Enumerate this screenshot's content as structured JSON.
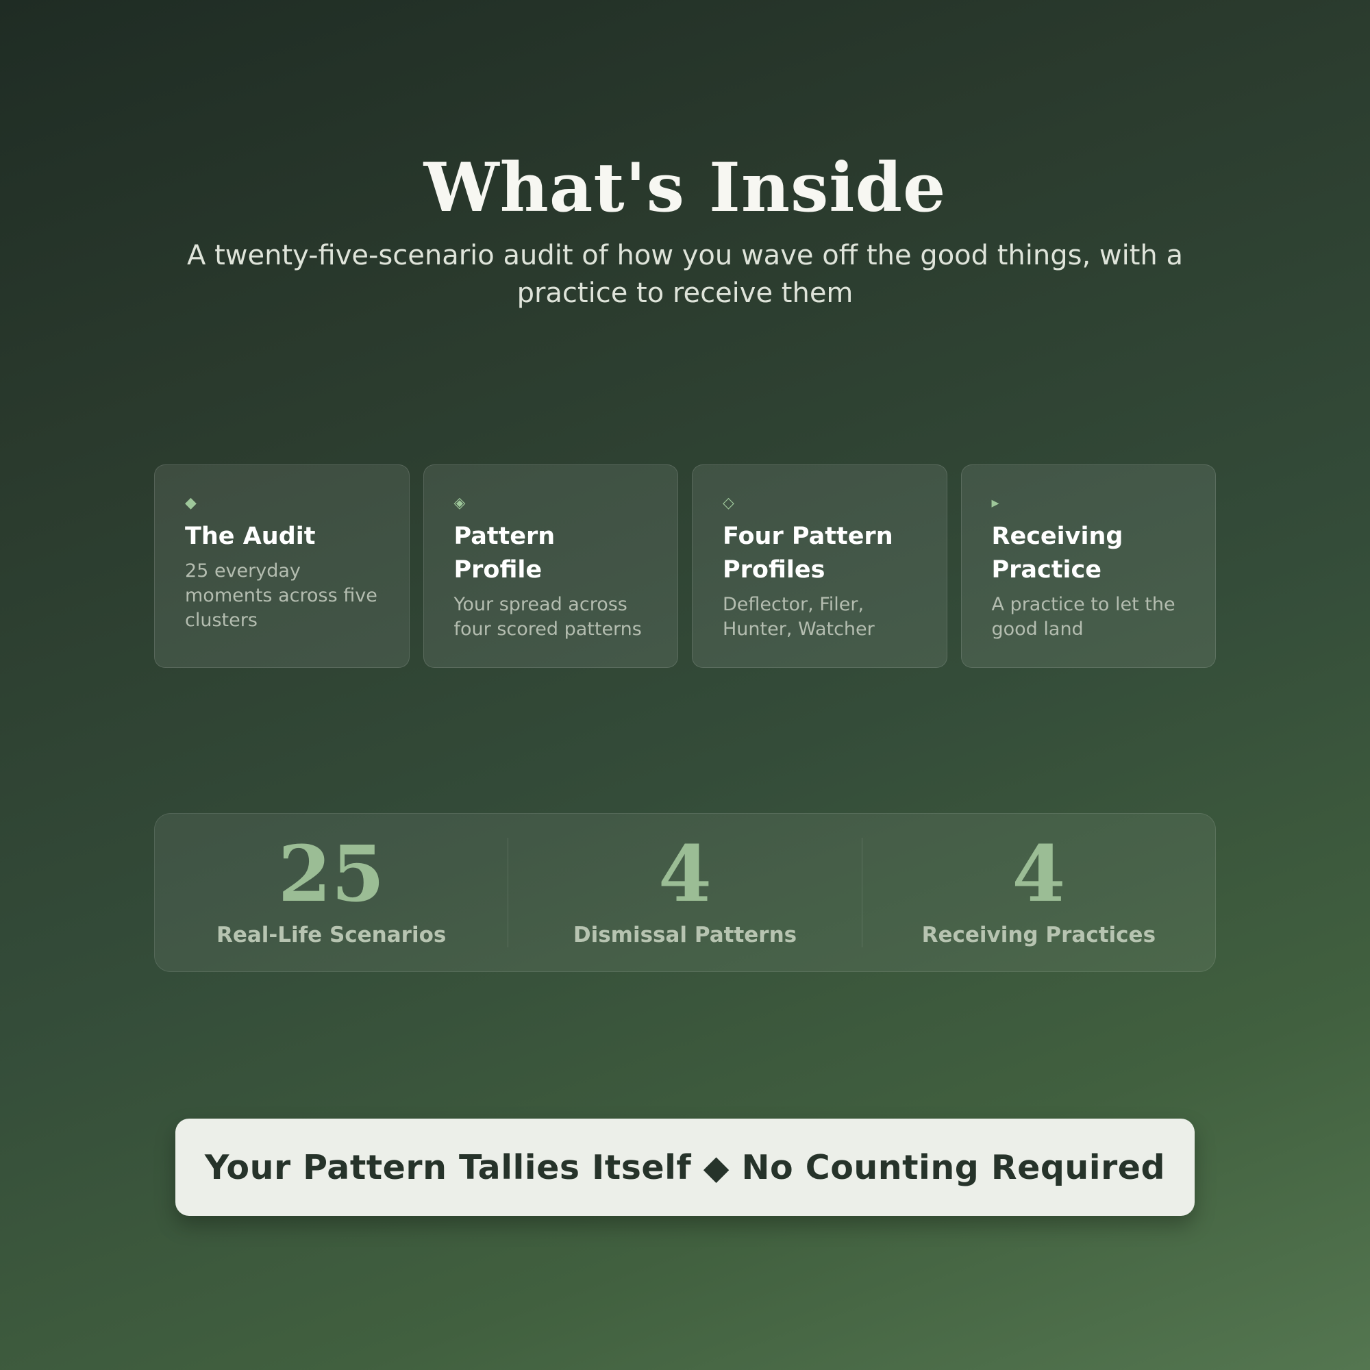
{
  "hero": {
    "title": "What's Inside",
    "subtitle": "A twenty-five-scenario audit of how you wave off the good things, with a practice to receive them"
  },
  "cards": [
    {
      "icon": "solid-diamond-icon",
      "icon_glyph": "◆",
      "title": "The Audit",
      "description": "25 everyday moments across five clusters"
    },
    {
      "icon": "diamond-in-diamond-icon",
      "icon_glyph": "◈",
      "title": "Pattern Profile",
      "description": "Your spread across four scored patterns"
    },
    {
      "icon": "outline-diamond-icon",
      "icon_glyph": "◇",
      "title": "Four Pattern Profiles",
      "description": "Deflector, Filer, Hunter, Watcher"
    },
    {
      "icon": "play-triangle-icon",
      "icon_glyph": "▸",
      "title": "Receiving Practice",
      "description": "A practice to let the good land"
    }
  ],
  "stats": [
    {
      "value": "25",
      "label": "Real-Life Scenarios"
    },
    {
      "value": "4",
      "label": "Dismissal Patterns"
    },
    {
      "value": "4",
      "label": "Receiving Practices"
    }
  ],
  "banner": {
    "text": "Your Pattern Tallies Itself ◆ No Counting Required"
  },
  "colors": {
    "background_top": "#1f2c24",
    "background_bottom": "#547650",
    "accent_green": "#9bbd95",
    "banner_bg": "#ecefe9",
    "banner_text": "#26332a"
  }
}
